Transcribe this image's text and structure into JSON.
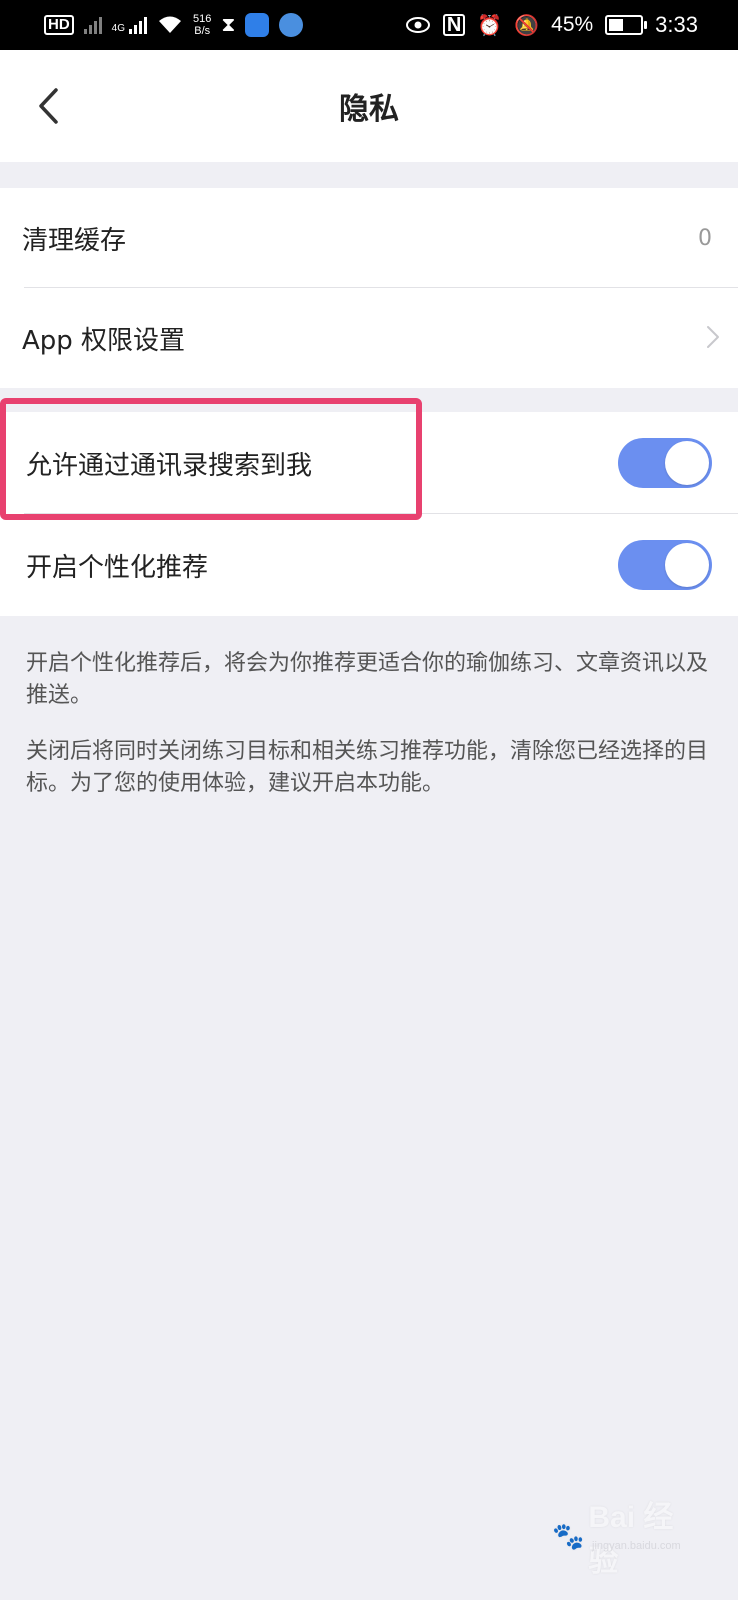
{
  "status_bar": {
    "net_speed_value": "516",
    "net_speed_unit": "B/s",
    "network_type": "4G",
    "battery_percent": "45%",
    "battery_level": 0.45,
    "time": "3:33"
  },
  "header": {
    "title": "隐私"
  },
  "settings": {
    "clear_cache": {
      "label": "清理缓存",
      "value": "0"
    },
    "app_permissions": {
      "label": "App 权限设置"
    },
    "contact_search": {
      "label": "允许通过通讯录搜索到我",
      "enabled": true
    },
    "personalized": {
      "label": "开启个性化推荐",
      "enabled": true
    }
  },
  "description": {
    "p1": "开启个性化推荐后，将会为你推荐更适合你的瑜伽练习、文章资讯以及推送。",
    "p2": "关闭后将同时关闭练习目标和相关练习推荐功能，清除您已经选择的目标。为了您的使用体验，建议开启本功能。"
  },
  "colors": {
    "toggle_on": "#6b8ff0",
    "highlight": "#e8416f",
    "background": "#efeff4"
  },
  "watermark": {
    "brand": "Bai 经验",
    "url": "jingyan.baidu.com"
  }
}
